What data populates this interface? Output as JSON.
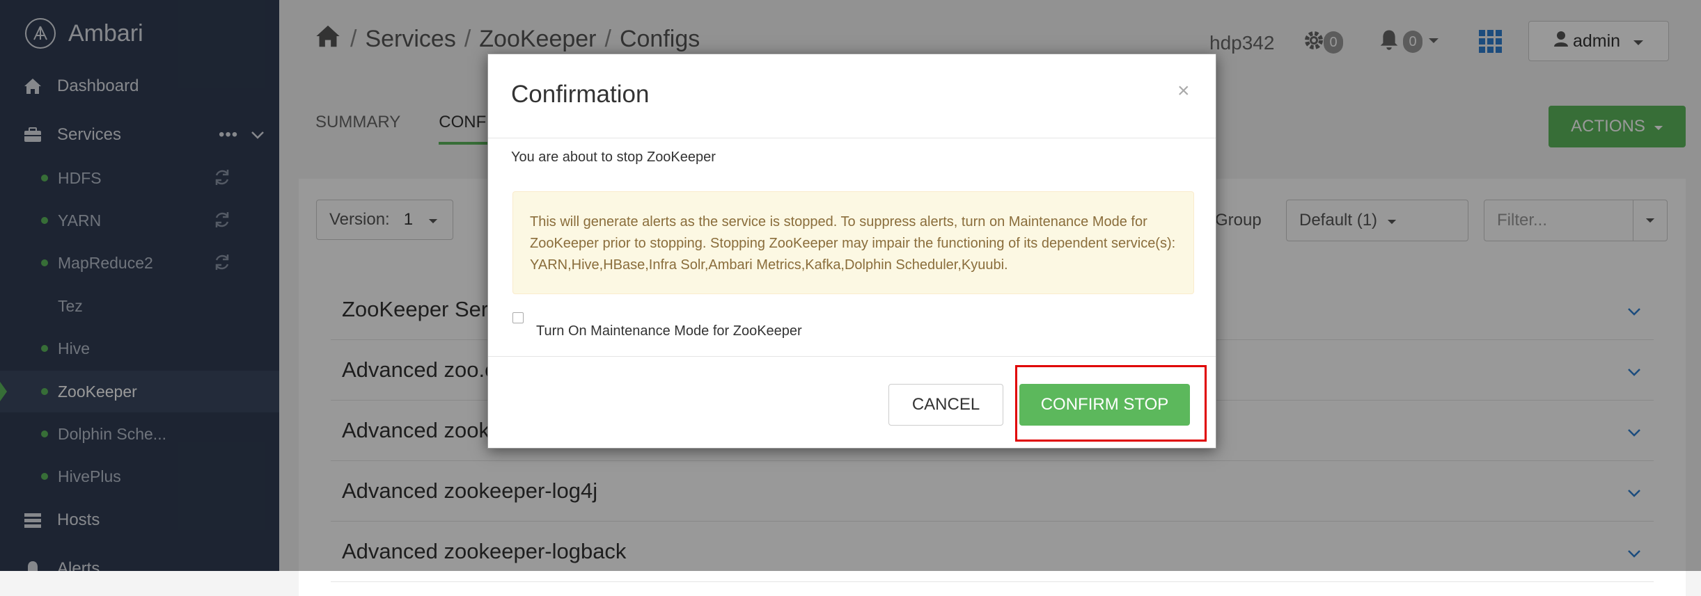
{
  "sidebar": {
    "brand": "Ambari",
    "dashboard": "Dashboard",
    "services": "Services",
    "services_more": "•••",
    "service_items": [
      {
        "label": "HDFS",
        "has_dot": true,
        "has_refresh": true
      },
      {
        "label": "YARN",
        "has_dot": true,
        "has_refresh": true
      },
      {
        "label": "MapReduce2",
        "has_dot": true,
        "has_refresh": true
      },
      {
        "label": "Tez",
        "has_dot": false,
        "has_refresh": false
      },
      {
        "label": "Hive",
        "has_dot": true,
        "has_refresh": false
      },
      {
        "label": "ZooKeeper",
        "has_dot": true,
        "has_refresh": false,
        "active": true
      },
      {
        "label": "Dolphin Sche...",
        "has_dot": true,
        "has_refresh": false
      },
      {
        "label": "HivePlus",
        "has_dot": true,
        "has_refresh": false
      }
    ],
    "hosts": "Hosts",
    "alerts": "Alerts"
  },
  "header": {
    "breadcrumb": [
      "Services",
      "ZooKeeper",
      "Configs"
    ],
    "cluster": "hdp342",
    "ops_count": "0",
    "alerts_count": "0",
    "user": "admin"
  },
  "tabs": [
    "SUMMARY",
    "CONFIGS"
  ],
  "actions_label": "ACTIONS",
  "configs": {
    "version_label": "Version:",
    "version_value": "1",
    "group_label": "g Group",
    "group_value": "Default (1)",
    "filter_placeholder": "Filter...",
    "sections": [
      "ZooKeeper Server",
      "Advanced zoo.cfg",
      "Advanced zookeeper-env",
      "Advanced zookeeper-log4j",
      "Advanced zookeeper-logback"
    ]
  },
  "modal": {
    "title": "Confirmation",
    "close": "×",
    "message": "You are about to stop ZooKeeper",
    "warning": "This will generate alerts as the service is stopped. To suppress alerts, turn on Maintenance Mode for ZooKeeper prior to stopping. Stopping ZooKeeper may impair the functioning of its dependent service(s): YARN,Hive,HBase,Infra Solr,Ambari Metrics,Kafka,Dolphin Scheduler,Kyuubi.",
    "checkbox_label": "Turn On Maintenance Mode for ZooKeeper",
    "checkbox_checked": false,
    "cancel_label": "CANCEL",
    "confirm_label": "CONFIRM STOP"
  },
  "colors": {
    "sidebar_bg": "#313d54",
    "accent_green": "#5cb85c",
    "highlight_red": "#e00000",
    "warning_bg": "#fcf8e3"
  }
}
